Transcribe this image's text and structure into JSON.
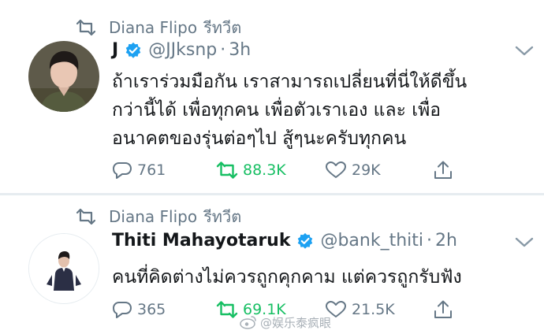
{
  "tweets": [
    {
      "retweeter": "Diana Flipo",
      "retweet_label": "รีทวีต",
      "name": "J",
      "handle": "@JJksnp",
      "separator": "·",
      "time": "3h",
      "text": [
        "ถ้าเราร่วมมือกัน เราสามารถเปลี่ยนที่นี่ให้ดีขึ้น",
        "กว่านี้ได้ เพื่อทุกคน เพื่อตัวเราเอง และ เพื่อ",
        "อนาคตของรุ่นต่อๆไป สู้ๆนะครับทุกคน"
      ],
      "replies": "761",
      "retweets": "88.3K",
      "likes": "29K"
    },
    {
      "retweeter": "Diana Flipo",
      "retweet_label": "รีทวีต",
      "name": "Thiti Mahayotaruk",
      "handle": "@bank_thiti",
      "separator": "·",
      "time": "2h",
      "text": [
        "คนที่คิดต่างไม่ควรถูกคุกคาม แต่ควรถูกรับฟัง"
      ],
      "replies": "365",
      "retweets": "69.1K",
      "likes": "21.5K"
    }
  ],
  "watermark": "@娱乐泰疯眼",
  "colors": {
    "text": "#14171a",
    "muted": "#657786",
    "verified": "#1da1f2",
    "retweet_active": "#17bf63",
    "divider": "#e6ecf0"
  },
  "icons": [
    "retweet-icon",
    "verified-badge-icon",
    "chevron-down-icon",
    "reply-icon",
    "like-icon",
    "share-icon"
  ]
}
